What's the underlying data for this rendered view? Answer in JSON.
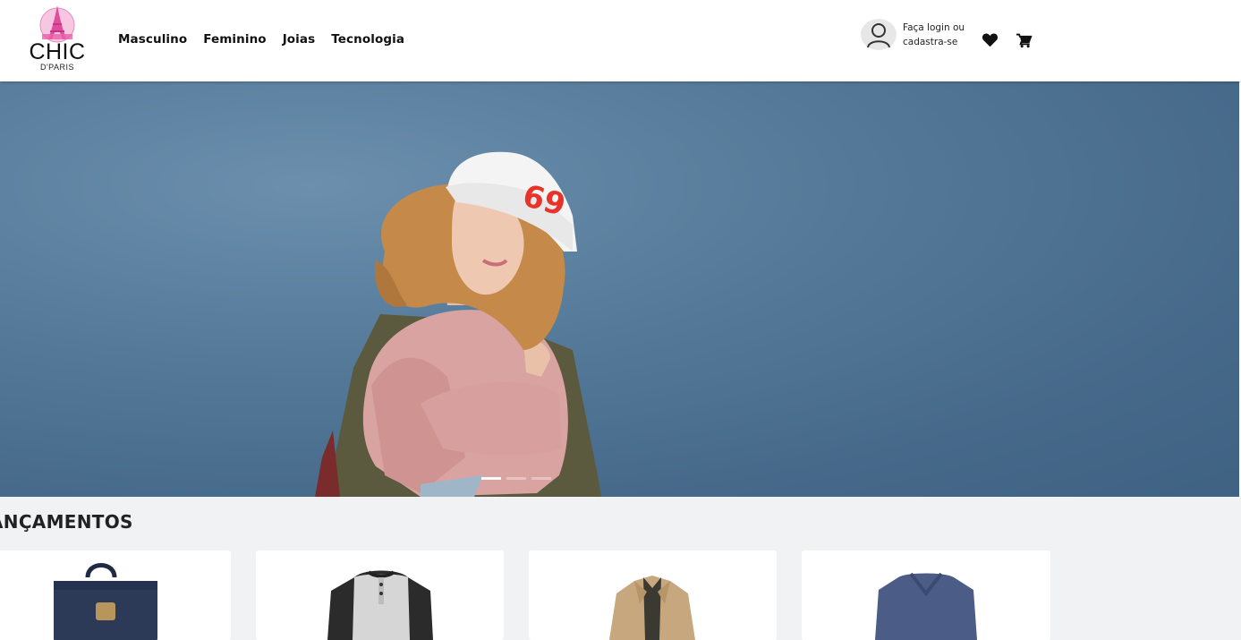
{
  "header": {
    "logo": {
      "title": "CHIC",
      "subtitle": "D'PARIS"
    },
    "nav": [
      {
        "label": "Masculino"
      },
      {
        "label": "Feminino"
      },
      {
        "label": "Joias"
      },
      {
        "label": "Tecnologia"
      }
    ],
    "account": {
      "line1": "Faça login ou",
      "line2": "cadastra-se",
      "icon": "user-icon"
    },
    "icons": [
      "heart-icon",
      "cart-icon"
    ]
  },
  "hero": {
    "cap_text": "69",
    "carousel": {
      "slides": 3,
      "active": 1
    }
  },
  "section": {
    "title": "ANÇAMENTOS"
  },
  "products": [
    {
      "icon": "backpack-icon"
    },
    {
      "icon": "henley-shirt-icon"
    },
    {
      "icon": "jacket-icon"
    },
    {
      "icon": "sweater-icon"
    }
  ],
  "colors": {
    "hero_bg": "#557a99",
    "page_bg": "#f1f2f4",
    "logo_pink": "#e85aa8"
  }
}
